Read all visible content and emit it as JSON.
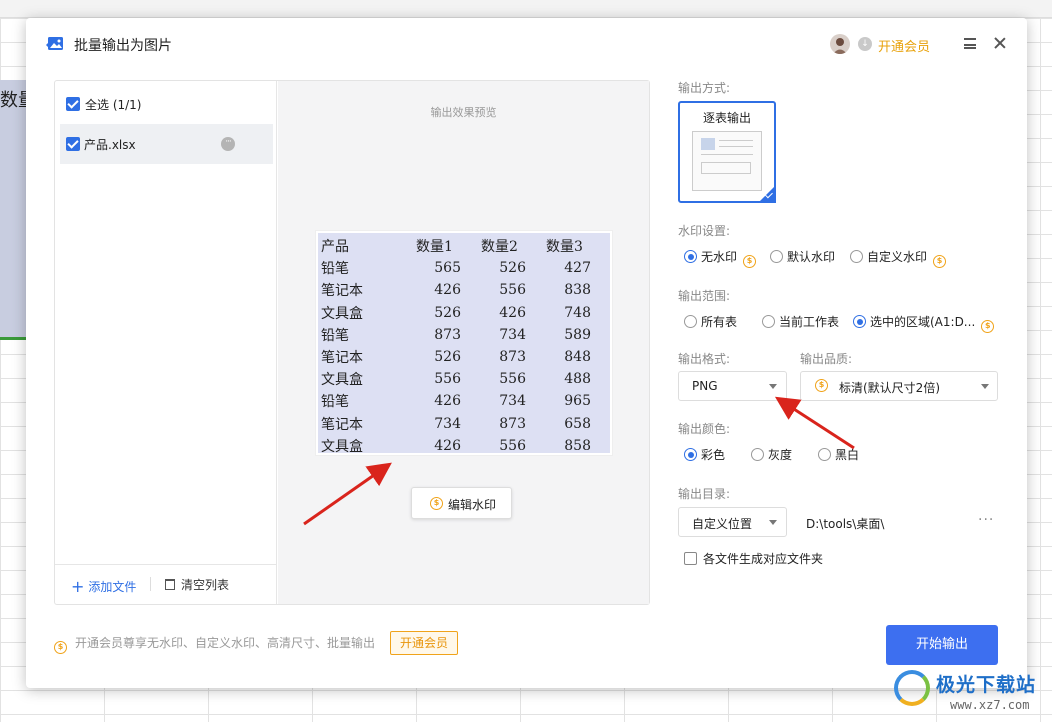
{
  "background": {
    "cell_text": "数量"
  },
  "dialog": {
    "title": "批量输出为图片",
    "vip_link": "开通会员"
  },
  "file_list": {
    "select_all": "全选 (1/1)",
    "files": [
      "产品.xlsx"
    ],
    "add_file": "添加文件",
    "clear_list": "清空列表"
  },
  "preview": {
    "title": "输出效果预览",
    "table": {
      "headers": [
        "产品",
        "数量1",
        "数量2",
        "数量3"
      ],
      "rows": [
        [
          "铅笔",
          "565",
          "526",
          "427"
        ],
        [
          "笔记本",
          "426",
          "556",
          "838"
        ],
        [
          "文具盒",
          "526",
          "426",
          "748"
        ],
        [
          "铅笔",
          "873",
          "734",
          "589"
        ],
        [
          "笔记本",
          "526",
          "873",
          "848"
        ],
        [
          "文具盒",
          "556",
          "556",
          "488"
        ],
        [
          "铅笔",
          "426",
          "734",
          "965"
        ],
        [
          "笔记本",
          "734",
          "873",
          "658"
        ],
        [
          "文具盒",
          "426",
          "556",
          "858"
        ]
      ]
    },
    "edit_watermark": "编辑水印"
  },
  "settings": {
    "output_mode_label": "输出方式:",
    "output_mode": "逐表输出",
    "watermark_label": "水印设置:",
    "watermark_options": [
      "无水印",
      "默认水印",
      "自定义水印"
    ],
    "watermark_selected": "无水印",
    "range_label": "输出范围:",
    "range_options": [
      "所有表",
      "当前工作表",
      "选中的区域(A1:D..."
    ],
    "range_selected": "选中的区域(A1:D...",
    "format_label": "输出格式:",
    "format_value": "PNG",
    "quality_label": "输出品质:",
    "quality_value": "标清(默认尺寸2倍)",
    "color_label": "输出颜色:",
    "color_options": [
      "彩色",
      "灰度",
      "黑白"
    ],
    "color_selected": "彩色",
    "dir_label": "输出目录:",
    "dir_mode": "自定义位置",
    "dir_path": "D:\\tools\\桌面\\",
    "subfolder_option": "各文件生成对应文件夹"
  },
  "footer": {
    "note": "开通会员尊享无水印、自定义水印、高清尺寸、批量输出",
    "vip_button": "开通会员",
    "start_button": "开始输出"
  },
  "watermark_site": {
    "title": "极光下载站",
    "url": "www.xz7.com"
  },
  "colors": {
    "accent": "#2f6fe4",
    "primary_button": "#3d6ff0",
    "vip": "#e8a20c",
    "arrow": "#d9241c",
    "preview_bg": "#dde0f3"
  }
}
